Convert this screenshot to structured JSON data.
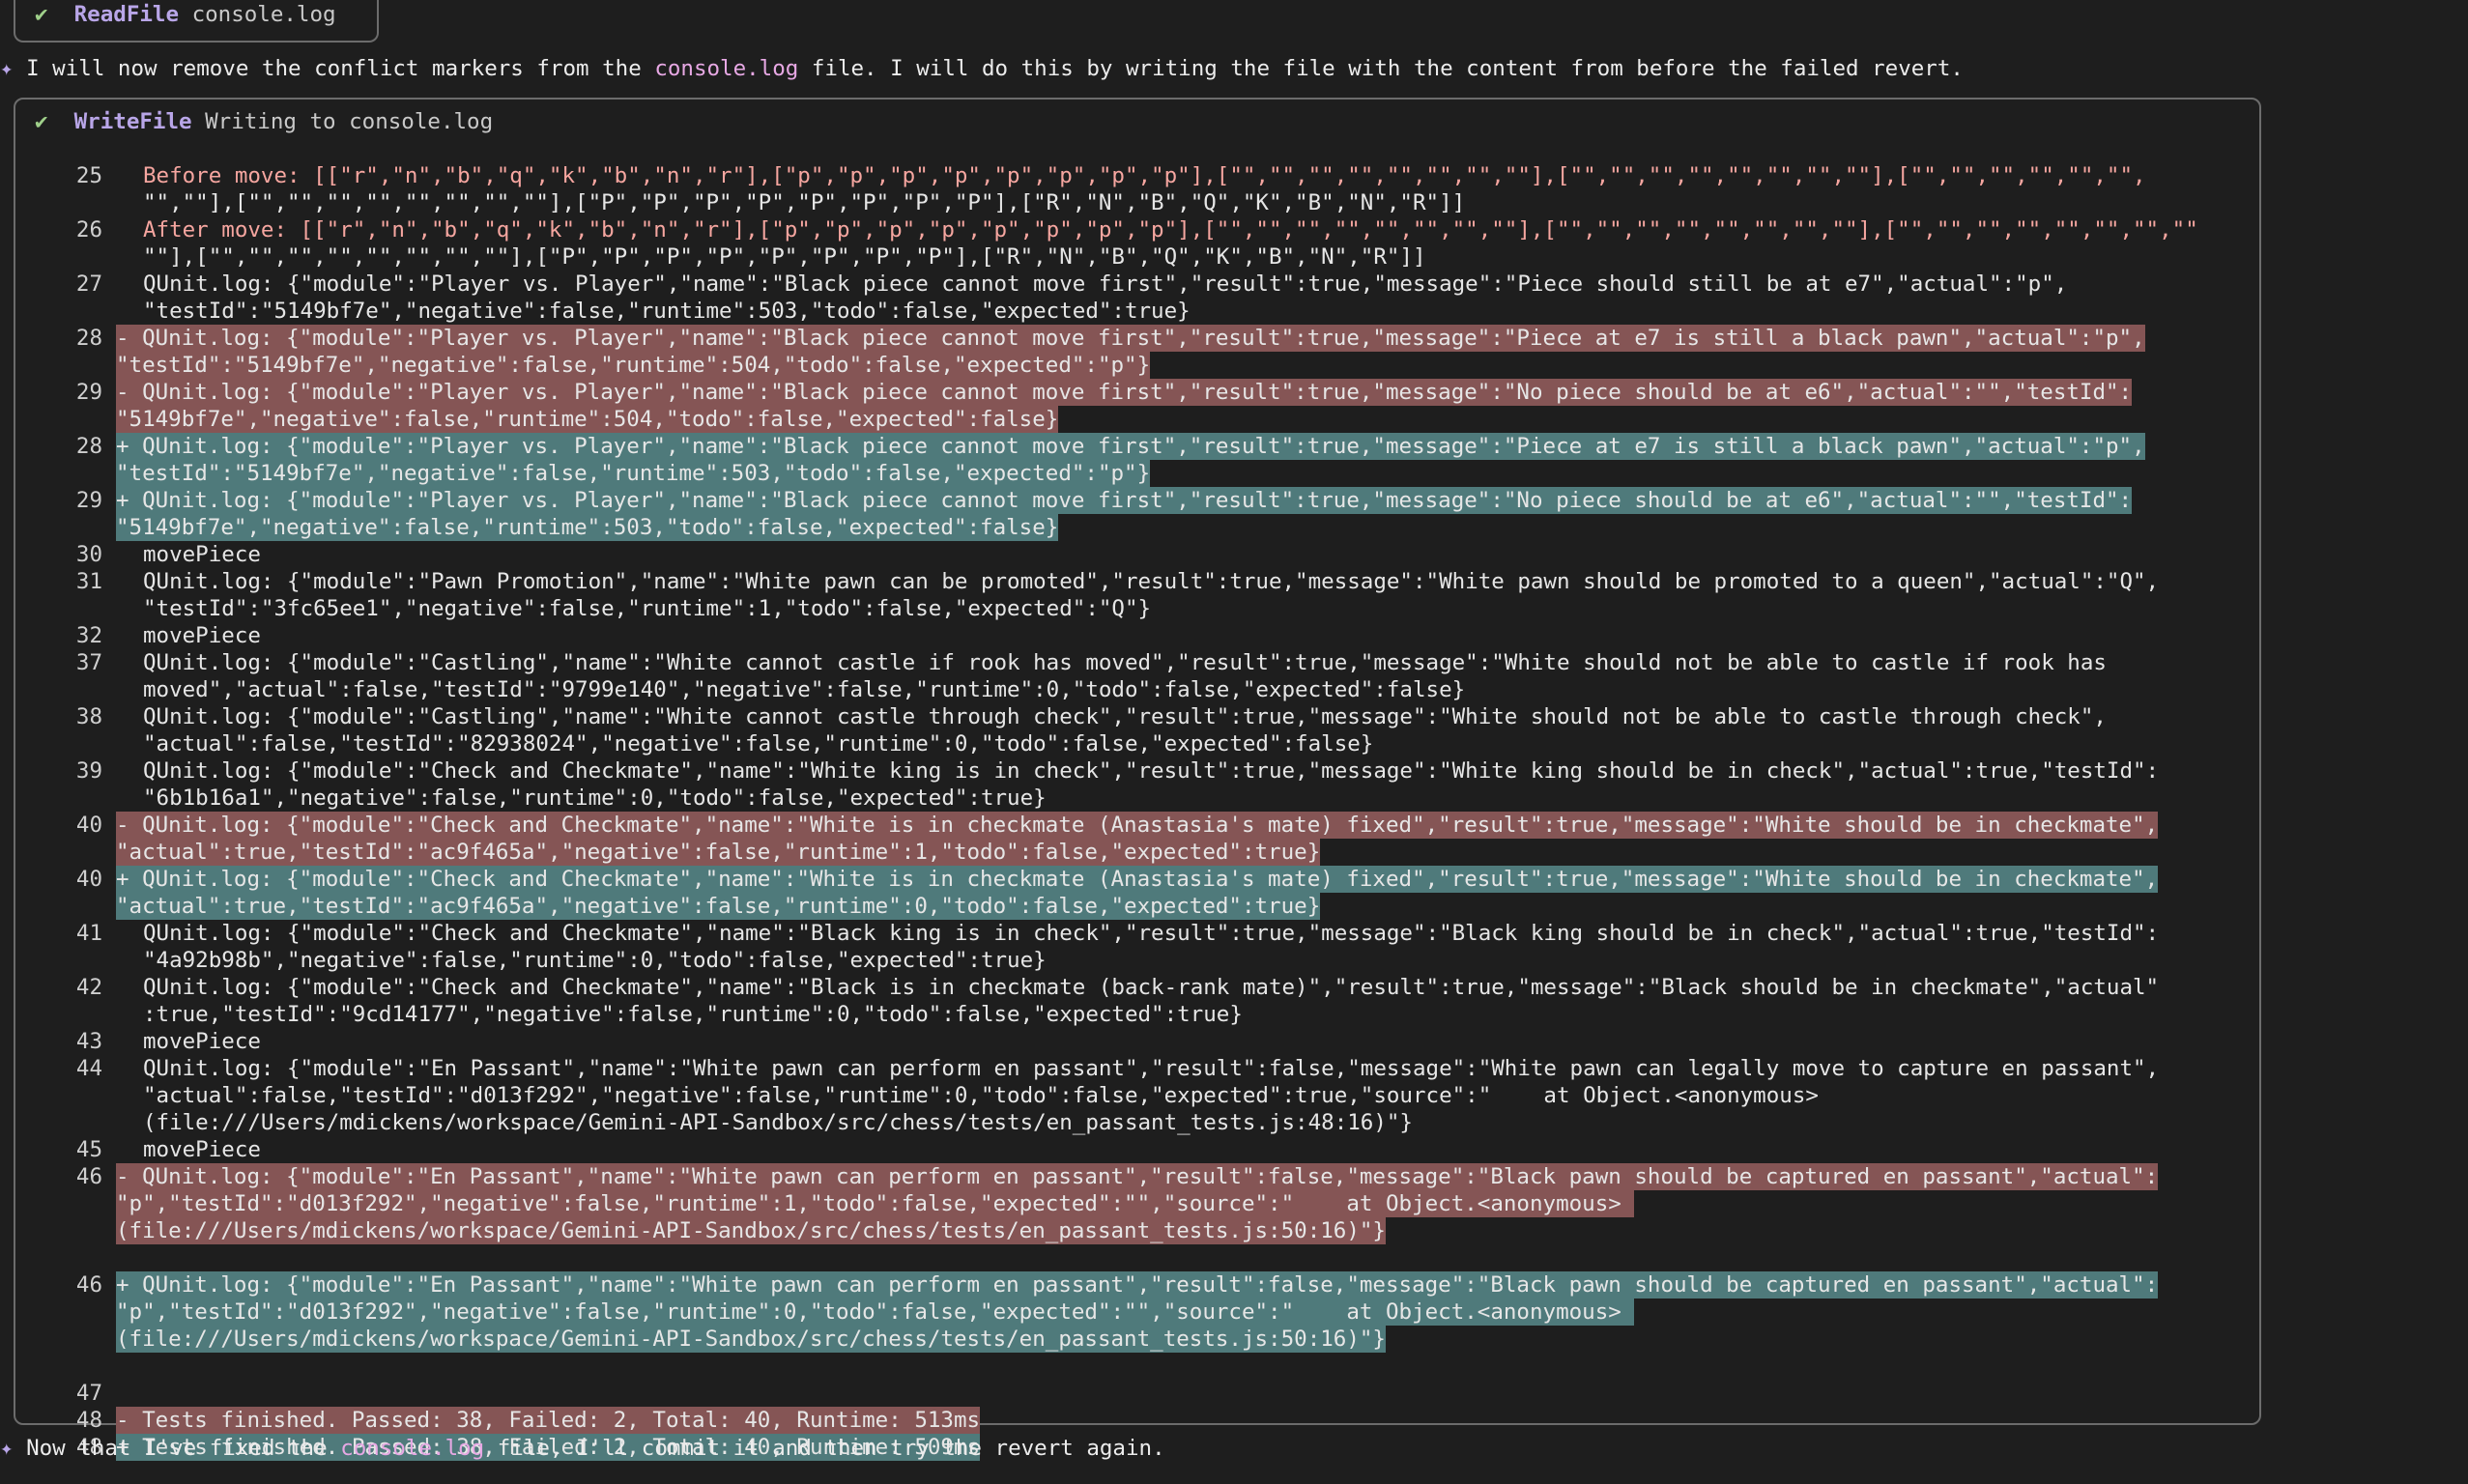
{
  "read_file": {
    "check": "✔",
    "tool": "ReadFile",
    "arg": "console.log"
  },
  "message1": {
    "bullet": "✦",
    "before": " I will now remove the conflict markers from the ",
    "code": "console.log",
    "after": " file. I will do this by writing the file with the content from before the failed revert."
  },
  "write_file": {
    "check": "✔",
    "tool": "WriteFile",
    "arg": "Writing to console.log"
  },
  "diff_lines": [
    {
      "ln": "25",
      "kind": "ctx",
      "rows": [
        "Before move: [[\"r\",\"n\",\"b\",\"q\",\"k\",\"b\",\"n\",\"r\"],[\"p\",\"p\",\"p\",\"p\",\"p\",\"p\",\"p\",\"p\"],[\"\",\"\",\"\",\"\",\"\",\"\",\"\",\"\"],[\"\",\"\",\"\",\"\",\"\",\"\",\"\",\"\"],[\"\",\"\",\"\",\"\",\"\",\"\",",
        "\"\",\"\"],[\"\",\"\",\"\",\"\",\"\",\"\",\"\",\"\"],[\"P\",\"P\",\"P\",\"P\",\"P\",\"P\",\"P\",\"P\"],[\"R\",\"N\",\"B\",\"Q\",\"K\",\"B\",\"N\",\"R\"]]"
      ]
    },
    {
      "ln": "26",
      "kind": "ctx",
      "rows": [
        "After move: [[\"r\",\"n\",\"b\",\"q\",\"k\",\"b\",\"n\",\"r\"],[\"p\",\"p\",\"p\",\"p\",\"p\",\"p\",\"p\",\"p\"],[\"\",\"\",\"\",\"\",\"\",\"\",\"\",\"\"],[\"\",\"\",\"\",\"\",\"\",\"\",\"\",\"\"],[\"\",\"\",\"\",\"\",\"\",\"\",\"\",\"\"",
        "\"\"],[\"\",\"\",\"\",\"\",\"\",\"\",\"\",\"\"],[\"P\",\"P\",\"P\",\"P\",\"P\",\"P\",\"P\",\"P\"],[\"R\",\"N\",\"B\",\"Q\",\"K\",\"B\",\"N\",\"R\"]]"
      ]
    },
    {
      "ln": "27",
      "kind": "ctx",
      "rows": [
        "QUnit.log: {\"module\":\"Player vs. Player\",\"name\":\"Black piece cannot move first\",\"result\":true,\"message\":\"Piece should still be at e7\",\"actual\":\"p\",",
        "\"testId\":\"5149bf7e\",\"negative\":false,\"runtime\":503,\"todo\":false,\"expected\":true}"
      ]
    },
    {
      "ln": "28",
      "kind": "del",
      "rows": [
        "- QUnit.log: {\"module\":\"Player vs. Player\",\"name\":\"Black piece cannot move first\",\"result\":true,\"message\":\"Piece at e7 is still a black pawn\",\"actual\":\"p\",",
        "\"testId\":\"5149bf7e\",\"negative\":false,\"runtime\":504,\"todo\":false,\"expected\":\"p\"}"
      ]
    },
    {
      "ln": "29",
      "kind": "del",
      "rows": [
        "- QUnit.log: {\"module\":\"Player vs. Player\",\"name\":\"Black piece cannot move first\",\"result\":true,\"message\":\"No piece should be at e6\",\"actual\":\"\",\"testId\":",
        "\"5149bf7e\",\"negative\":false,\"runtime\":504,\"todo\":false,\"expected\":false}"
      ]
    },
    {
      "ln": "28",
      "kind": "add",
      "rows": [
        "+ QUnit.log: {\"module\":\"Player vs. Player\",\"name\":\"Black piece cannot move first\",\"result\":true,\"message\":\"Piece at e7 is still a black pawn\",\"actual\":\"p\",",
        "\"testId\":\"5149bf7e\",\"negative\":false,\"runtime\":503,\"todo\":false,\"expected\":\"p\"}"
      ]
    },
    {
      "ln": "29",
      "kind": "add",
      "rows": [
        "+ QUnit.log: {\"module\":\"Player vs. Player\",\"name\":\"Black piece cannot move first\",\"result\":true,\"message\":\"No piece should be at e6\",\"actual\":\"\",\"testId\":",
        "\"5149bf7e\",\"negative\":false,\"runtime\":503,\"todo\":false,\"expected\":false}"
      ]
    },
    {
      "ln": "30",
      "kind": "ctx",
      "rows": [
        "movePiece"
      ]
    },
    {
      "ln": "31",
      "kind": "ctx",
      "rows": [
        "QUnit.log: {\"module\":\"Pawn Promotion\",\"name\":\"White pawn can be promoted\",\"result\":true,\"message\":\"White pawn should be promoted to a queen\",\"actual\":\"Q\",",
        "\"testId\":\"3fc65ee1\",\"negative\":false,\"runtime\":1,\"todo\":false,\"expected\":\"Q\"}"
      ]
    },
    {
      "ln": "32",
      "kind": "ctx",
      "rows": [
        "movePiece"
      ]
    },
    {
      "ln": "37",
      "kind": "ctx",
      "rows": [
        "QUnit.log: {\"module\":\"Castling\",\"name\":\"White cannot castle if rook has moved\",\"result\":true,\"message\":\"White should not be able to castle if rook has",
        "moved\",\"actual\":false,\"testId\":\"9799e140\",\"negative\":false,\"runtime\":0,\"todo\":false,\"expected\":false}"
      ]
    },
    {
      "ln": "38",
      "kind": "ctx",
      "rows": [
        "QUnit.log: {\"module\":\"Castling\",\"name\":\"White cannot castle through check\",\"result\":true,\"message\":\"White should not be able to castle through check\",",
        "\"actual\":false,\"testId\":\"82938024\",\"negative\":false,\"runtime\":0,\"todo\":false,\"expected\":false}"
      ]
    },
    {
      "ln": "39",
      "kind": "ctx",
      "rows": [
        "QUnit.log: {\"module\":\"Check and Checkmate\",\"name\":\"White king is in check\",\"result\":true,\"message\":\"White king should be in check\",\"actual\":true,\"testId\":",
        "\"6b1b16a1\",\"negative\":false,\"runtime\":0,\"todo\":false,\"expected\":true}"
      ]
    },
    {
      "ln": "40",
      "kind": "del",
      "rows": [
        "- QUnit.log: {\"module\":\"Check and Checkmate\",\"name\":\"White is in checkmate (Anastasia's mate) fixed\",\"result\":true,\"message\":\"White should be in checkmate\",",
        "\"actual\":true,\"testId\":\"ac9f465a\",\"negative\":false,\"runtime\":1,\"todo\":false,\"expected\":true}"
      ]
    },
    {
      "ln": "40",
      "kind": "add",
      "rows": [
        "+ QUnit.log: {\"module\":\"Check and Checkmate\",\"name\":\"White is in checkmate (Anastasia's mate) fixed\",\"result\":true,\"message\":\"White should be in checkmate\",",
        "\"actual\":true,\"testId\":\"ac9f465a\",\"negative\":false,\"runtime\":0,\"todo\":false,\"expected\":true}"
      ]
    },
    {
      "ln": "41",
      "kind": "ctx",
      "rows": [
        "QUnit.log: {\"module\":\"Check and Checkmate\",\"name\":\"Black king is in check\",\"result\":true,\"message\":\"Black king should be in check\",\"actual\":true,\"testId\":",
        "\"4a92b98b\",\"negative\":false,\"runtime\":0,\"todo\":false,\"expected\":true}"
      ]
    },
    {
      "ln": "42",
      "kind": "ctx",
      "rows": [
        "QUnit.log: {\"module\":\"Check and Checkmate\",\"name\":\"Black is in checkmate (back-rank mate)\",\"result\":true,\"message\":\"Black should be in checkmate\",\"actual\"",
        ":true,\"testId\":\"9cd14177\",\"negative\":false,\"runtime\":0,\"todo\":false,\"expected\":true}"
      ]
    },
    {
      "ln": "43",
      "kind": "ctx",
      "rows": [
        "movePiece"
      ]
    },
    {
      "ln": "44",
      "kind": "ctx",
      "rows": [
        "QUnit.log: {\"module\":\"En Passant\",\"name\":\"White pawn can perform en passant\",\"result\":false,\"message\":\"White pawn can legally move to capture en passant\",",
        "\"actual\":false,\"testId\":\"d013f292\",\"negative\":false,\"runtime\":0,\"todo\":false,\"expected\":true,\"source\":\"    at Object.<anonymous>",
        "(file:///Users/mdickens/workspace/Gemini-API-Sandbox/src/chess/tests/en_passant_tests.js:48:16)\"}"
      ]
    },
    {
      "ln": "45",
      "kind": "ctx",
      "rows": [
        "movePiece"
      ]
    },
    {
      "ln": "46",
      "kind": "del",
      "rows": [
        "- QUnit.log: {\"module\":\"En Passant\",\"name\":\"White pawn can perform en passant\",\"result\":false,\"message\":\"Black pawn should be captured en passant\",\"actual\":",
        "\"p\",\"testId\":\"d013f292\",\"negative\":false,\"runtime\":1,\"todo\":false,\"expected\":\"\",\"source\":\"    at Object.<anonymous> ",
        "(file:///Users/mdickens/workspace/Gemini-API-Sandbox/src/chess/tests/en_passant_tests.js:50:16)\"}"
      ]
    },
    {
      "ln": "",
      "kind": "ctx",
      "rows": [
        ""
      ]
    },
    {
      "ln": "46",
      "kind": "add",
      "rows": [
        "+ QUnit.log: {\"module\":\"En Passant\",\"name\":\"White pawn can perform en passant\",\"result\":false,\"message\":\"Black pawn should be captured en passant\",\"actual\":",
        "\"p\",\"testId\":\"d013f292\",\"negative\":false,\"runtime\":0,\"todo\":false,\"expected\":\"\",\"source\":\"    at Object.<anonymous> ",
        "(file:///Users/mdickens/workspace/Gemini-API-Sandbox/src/chess/tests/en_passant_tests.js:50:16)\"}"
      ]
    },
    {
      "ln": "",
      "kind": "ctx",
      "rows": [
        ""
      ]
    },
    {
      "ln": "47",
      "kind": "ctx",
      "rows": [
        ""
      ]
    },
    {
      "ln": "48",
      "kind": "del",
      "rows": [
        "- Tests finished. Passed: 38, Failed: 2, Total: 40, Runtime: 513ms"
      ]
    },
    {
      "ln": "48",
      "kind": "add",
      "rows": [
        "+ Tests finished. Passed: 38, Failed: 2, Total: 40, Runtime: 509ms"
      ]
    }
  ],
  "message2": {
    "bullet": "✦",
    "before": " Now that I've fixed the ",
    "code": "console.log",
    "after": " file, I'll commit it and then try the revert again."
  }
}
